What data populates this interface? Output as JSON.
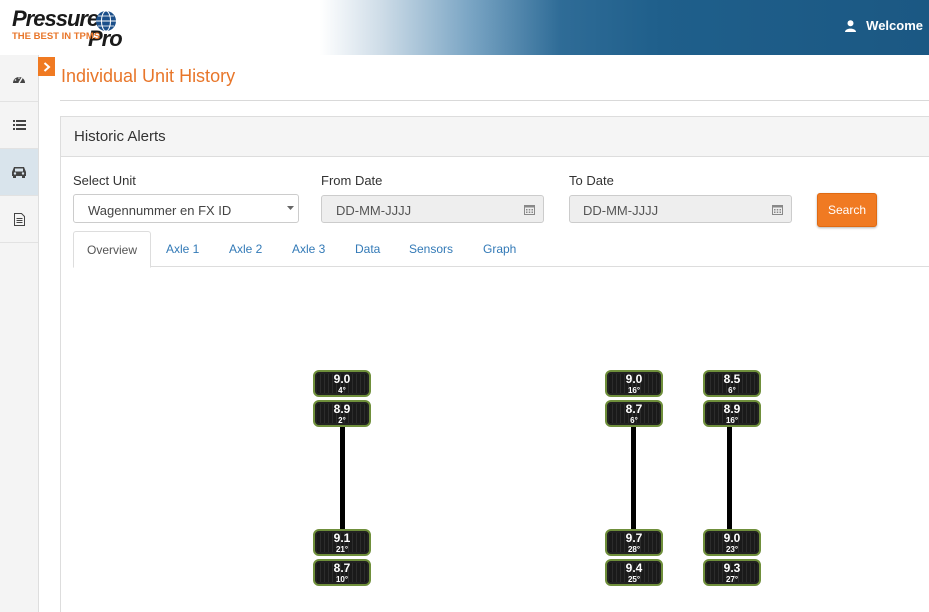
{
  "brand": {
    "name_part1": "Pressure",
    "name_part2": "Pro",
    "tagline": "THE BEST IN TPMS"
  },
  "header": {
    "welcome": "Welcome"
  },
  "sidebar": {
    "icons": [
      "dashboard-icon",
      "list-icon",
      "car-icon",
      "document-icon"
    ],
    "active_index": 2
  },
  "page": {
    "title": "Individual Unit History"
  },
  "panel": {
    "title": "Historic Alerts"
  },
  "form": {
    "unit_label": "Select Unit",
    "unit_value": "Wagennummer en FX ID",
    "from_label": "From Date",
    "from_placeholder": "DD-MM-JJJJ",
    "to_label": "To Date",
    "to_placeholder": "DD-MM-JJJJ",
    "search_label": "Search"
  },
  "tabs": [
    "Overview",
    "Axle 1",
    "Axle 2",
    "Axle 3",
    "Data",
    "Sensors",
    "Graph"
  ],
  "active_tab": 0,
  "colors": {
    "accent": "#f07a22",
    "link": "#337ab7",
    "tire_border": "#6f8f3b"
  },
  "axles": [
    {
      "top": [
        {
          "pressure": "9.0",
          "temp": "4°"
        },
        {
          "pressure": "8.9",
          "temp": "2°"
        }
      ],
      "bottom": [
        {
          "pressure": "9.1",
          "temp": "21°"
        },
        {
          "pressure": "8.7",
          "temp": "10°"
        }
      ]
    },
    {
      "top": [
        {
          "pressure": "9.0",
          "temp": "16°"
        },
        {
          "pressure": "8.7",
          "temp": "6°"
        }
      ],
      "bottom": [
        {
          "pressure": "9.7",
          "temp": "28°"
        },
        {
          "pressure": "9.4",
          "temp": "25°"
        }
      ]
    },
    {
      "top": [
        {
          "pressure": "8.5",
          "temp": "6°"
        },
        {
          "pressure": "8.9",
          "temp": "16°"
        }
      ],
      "bottom": [
        {
          "pressure": "9.0",
          "temp": "23°"
        },
        {
          "pressure": "9.3",
          "temp": "27°"
        }
      ]
    }
  ]
}
